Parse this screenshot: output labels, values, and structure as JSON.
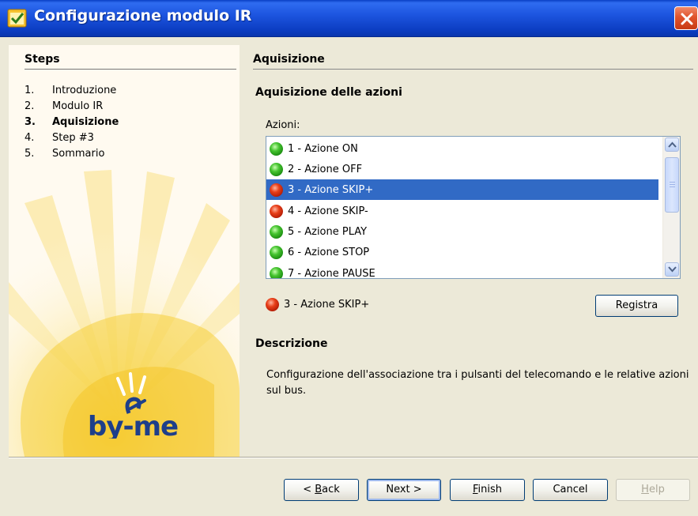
{
  "window": {
    "title": "Configurazione modulo IR",
    "icon": "app-icon",
    "close_icon": "close-icon"
  },
  "sidebar": {
    "title": "Steps",
    "steps": [
      {
        "num": "1.",
        "label": "Introduzione",
        "active": false
      },
      {
        "num": "2.",
        "label": "Modulo IR",
        "active": false
      },
      {
        "num": "3.",
        "label": "Aquisizione",
        "active": true
      },
      {
        "num": "4.",
        "label": "Step #3",
        "active": false
      },
      {
        "num": "5.",
        "label": "Sommario",
        "active": false
      }
    ],
    "logo_text": "by-me"
  },
  "panel": {
    "title": "Aquisizione",
    "section_title": "Aquisizione delle azioni",
    "list_label": "Azioni:",
    "actions": [
      {
        "label": "1 - Azione ON",
        "status": "green",
        "selected": false
      },
      {
        "label": "2 - Azione OFF",
        "status": "green",
        "selected": false
      },
      {
        "label": "3 - Azione SKIP+",
        "status": "red",
        "selected": true
      },
      {
        "label": "4 - Azione SKIP-",
        "status": "red",
        "selected": false
      },
      {
        "label": "5 - Azione PLAY",
        "status": "green",
        "selected": false
      },
      {
        "label": "6 - Azione STOP",
        "status": "green",
        "selected": false
      },
      {
        "label": "7 - Azione PAUSE",
        "status": "green",
        "selected": false
      }
    ],
    "current_action": {
      "label": "3 - Azione SKIP+",
      "status": "red"
    },
    "record_button": "Registra",
    "description_title": "Descrizione",
    "description_text": "Configurazione dell'associazione tra i pulsanti del telecomando e le relative azioni sul bus."
  },
  "buttons": {
    "back": {
      "prefix": "< ",
      "mnemonic": "B",
      "rest": "ack"
    },
    "next": "Next >",
    "finish": {
      "mnemonic": "F",
      "rest": "inish"
    },
    "cancel": "Cancel",
    "help": {
      "mnemonic": "H",
      "rest": "elp",
      "enabled": false
    }
  },
  "colors": {
    "titlebar": "#0a3fc4",
    "selection": "#316ac5",
    "status_green": "#46c430",
    "status_red": "#e8401a",
    "sidebar_bg": "#fffaf0"
  }
}
